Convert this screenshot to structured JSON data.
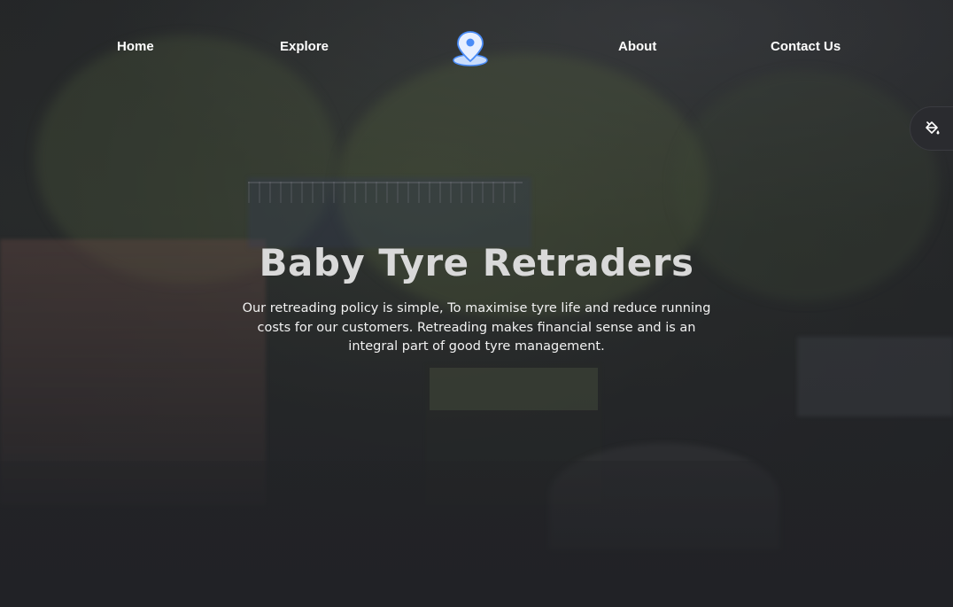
{
  "nav": {
    "home_label": "Home",
    "explore_label": "Explore",
    "about_label": "About",
    "contact_label": "Contact Us",
    "logo_icon": "map-pin-icon",
    "logo_color": "#4a8cf7"
  },
  "theme_switcher": {
    "icon": "paint-bucket-icon"
  },
  "hero": {
    "title": "Baby Tyre Retraders",
    "description": "Our retreading policy is simple, To maximise tyre life and reduce running costs for our customers. Retreading makes financial sense and is an integral part of good tyre management."
  },
  "colors": {
    "background": "#202124",
    "title": "#d9d9d9",
    "text": "#ffffff"
  }
}
